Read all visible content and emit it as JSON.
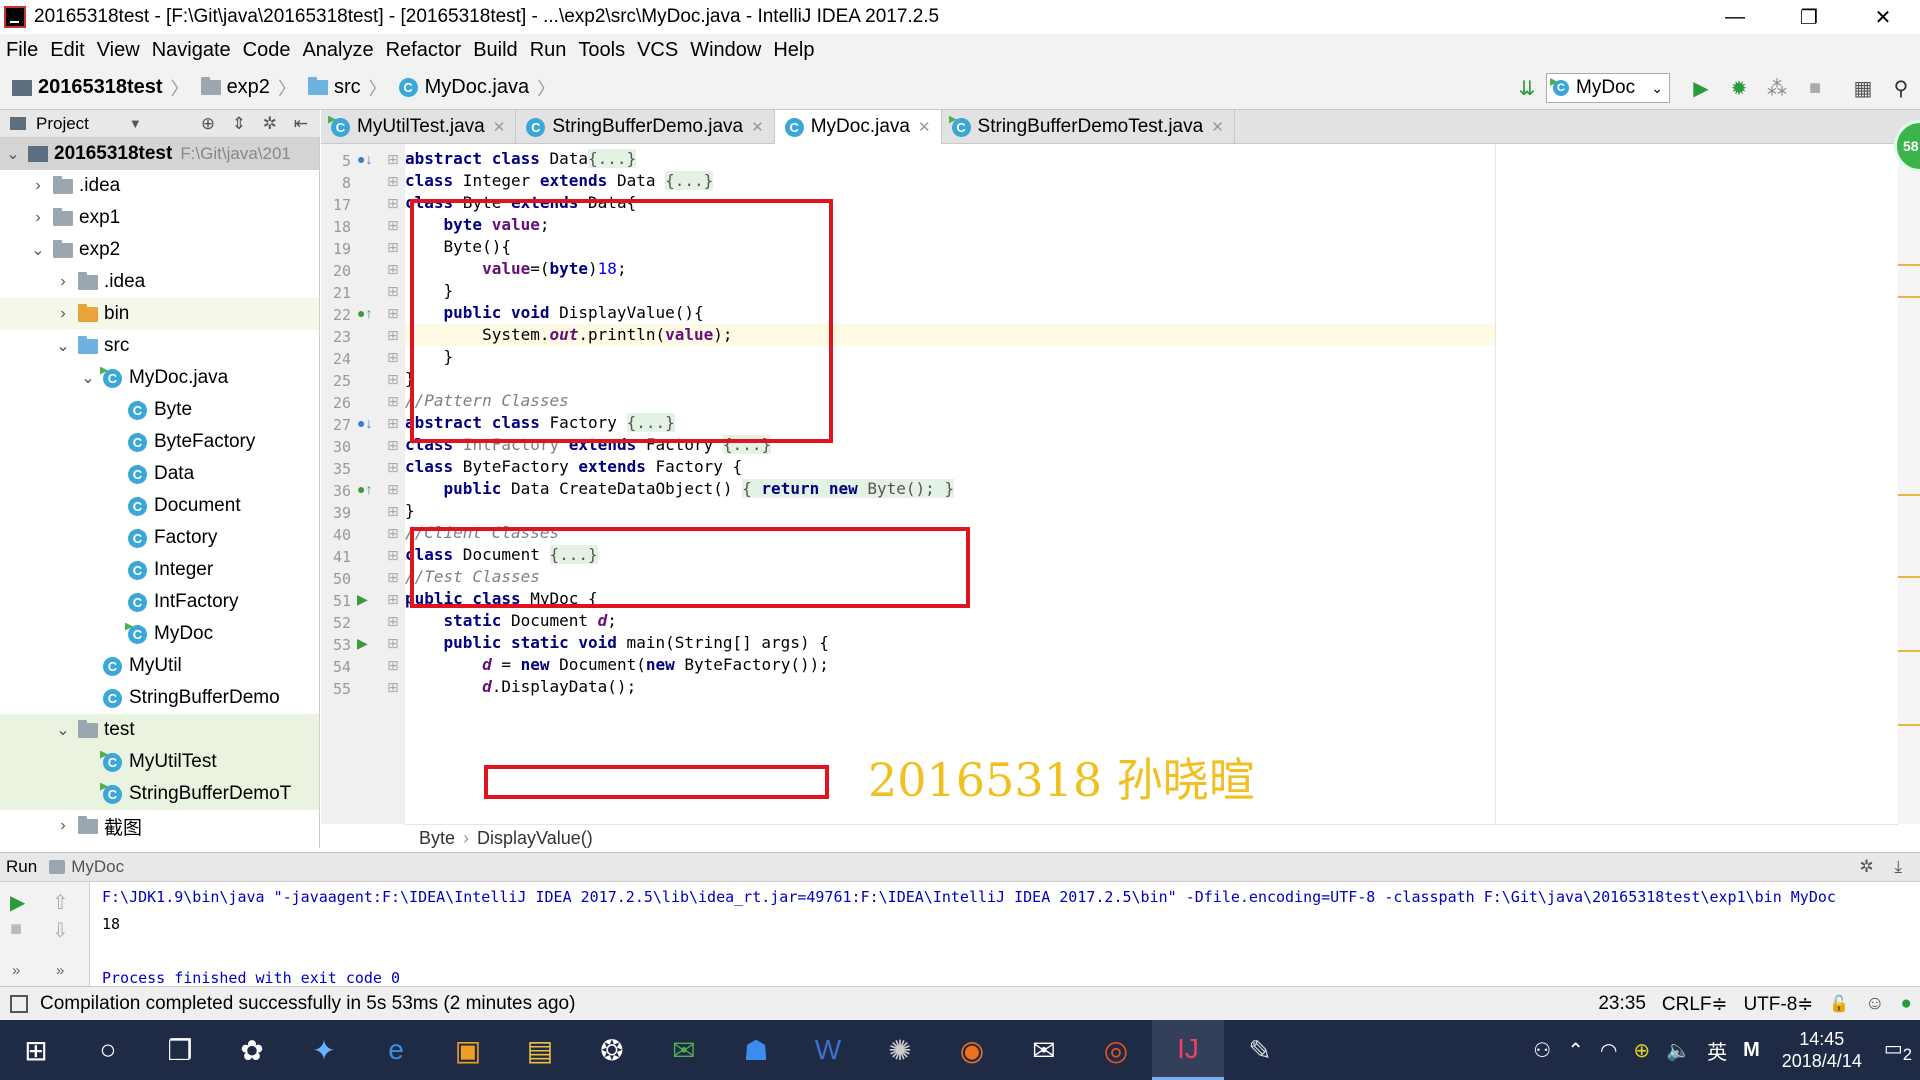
{
  "window": {
    "title": "20165318test - [F:\\Git\\java\\20165318test] - [20165318test] - ...\\exp2\\src\\MyDoc.java - IntelliJ IDEA 2017.2.5",
    "controls": [
      "—",
      "❐",
      "✕"
    ]
  },
  "menu": [
    "File",
    "Edit",
    "View",
    "Navigate",
    "Code",
    "Analyze",
    "Refactor",
    "Build",
    "Run",
    "Tools",
    "VCS",
    "Window",
    "Help"
  ],
  "nav": {
    "breadcrumbs": [
      "20165318test",
      "exp2",
      "src",
      "MyDoc.java"
    ],
    "run_config": "MyDoc"
  },
  "project_panel": {
    "title": "Project",
    "icons": "⊕ ⇕ ✲ ⇤"
  },
  "tree": [
    {
      "label": "20165318test",
      "muted": "F:\\Git\\java\\201",
      "level": 0,
      "arrow": "⌄",
      "kind": "module",
      "state": "sel"
    },
    {
      "label": ".idea",
      "level": 1,
      "arrow": "›",
      "kind": "folder"
    },
    {
      "label": "exp1",
      "level": 1,
      "arrow": "›",
      "kind": "folder"
    },
    {
      "label": "exp2",
      "level": 1,
      "arrow": "⌄",
      "kind": "folder"
    },
    {
      "label": ".idea",
      "level": 2,
      "arrow": "›",
      "kind": "folder"
    },
    {
      "label": "bin",
      "level": 2,
      "arrow": "›",
      "kind": "folder-orange",
      "state": "hl"
    },
    {
      "label": "src",
      "level": 2,
      "arrow": "⌄",
      "kind": "folder-blue"
    },
    {
      "label": "MyDoc.java",
      "level": 3,
      "arrow": "⌄",
      "kind": "class-run"
    },
    {
      "label": "Byte",
      "level": 4,
      "arrow": "",
      "kind": "class"
    },
    {
      "label": "ByteFactory",
      "level": 4,
      "arrow": "",
      "kind": "class"
    },
    {
      "label": "Data",
      "level": 4,
      "arrow": "",
      "kind": "class"
    },
    {
      "label": "Document",
      "level": 4,
      "arrow": "",
      "kind": "class"
    },
    {
      "label": "Factory",
      "level": 4,
      "arrow": "",
      "kind": "class"
    },
    {
      "label": "Integer",
      "level": 4,
      "arrow": "",
      "kind": "class"
    },
    {
      "label": "IntFactory",
      "level": 4,
      "arrow": "",
      "kind": "class"
    },
    {
      "label": "MyDoc",
      "level": 4,
      "arrow": "",
      "kind": "class-run"
    },
    {
      "label": "MyUtil",
      "level": 3,
      "arrow": "",
      "kind": "class"
    },
    {
      "label": "StringBufferDemo",
      "level": 3,
      "arrow": "",
      "kind": "class"
    },
    {
      "label": "test",
      "level": 2,
      "arrow": "⌄",
      "kind": "folder",
      "state": "hl2"
    },
    {
      "label": "MyUtilTest",
      "level": 3,
      "arrow": "",
      "kind": "class-run",
      "state": "hl2"
    },
    {
      "label": "StringBufferDemoT",
      "level": 3,
      "arrow": "",
      "kind": "class-run",
      "state": "hl2"
    },
    {
      "label": "截图",
      "level": 2,
      "arrow": "›",
      "kind": "folder"
    }
  ],
  "tabs": [
    {
      "label": "MyUtilTest.java",
      "active": false,
      "icon": "class-run"
    },
    {
      "label": "StringBufferDemo.java",
      "active": false,
      "icon": "class"
    },
    {
      "label": "MyDoc.java",
      "active": true,
      "icon": "class"
    },
    {
      "label": "StringBufferDemoTest.java",
      "active": false,
      "icon": "class-run"
    }
  ],
  "editor": {
    "lines": [
      {
        "n": "5",
        "html": "<span class='kw'>abstract class</span> Data<span class='fold'>{...}</span>",
        "mark": "impl"
      },
      {
        "n": "8",
        "html": "<span class='kw'>class</span> Integer <span class='kw'>extends</span> Data <span class='fold'>{...}</span>"
      },
      {
        "n": "17",
        "html": "<span class='kw'>class</span> Byte <span class='kw'>extends</span> Data{"
      },
      {
        "n": "18",
        "html": "    <span class='kw'>byte</span> <span class='fld'>value</span>;"
      },
      {
        "n": "19",
        "html": "    Byte(){"
      },
      {
        "n": "20",
        "html": "        <span class='fld'>value</span>=(<span class='kw'>byte</span>)<span class='num'>18</span>;"
      },
      {
        "n": "21",
        "html": "    }"
      },
      {
        "n": "22",
        "html": "    <span class='kw'>public void</span> DisplayValue(){",
        "mark": "override"
      },
      {
        "n": "23",
        "html": "        System.<span class='fld it'>out</span>.println(<span class='fld'>value</span>);",
        "current": true
      },
      {
        "n": "24",
        "html": "    }"
      },
      {
        "n": "25",
        "html": "}"
      },
      {
        "n": "26",
        "html": "<span class='cm'>//Pattern Classes</span>"
      },
      {
        "n": "27",
        "html": "<span class='kw'>abstract class</span> Factory <span class='fold'>{...}</span>",
        "mark": "impl"
      },
      {
        "n": "30",
        "html": "<span class='kw'>class</span> <span class='unused'>IntFactory</span> <span class='kw'>extends</span> Factory <span class='fold'>{...}</span>"
      },
      {
        "n": "35",
        "html": "<span class='kw'>class</span> ByteFactory <span class='kw'>extends</span> Factory {"
      },
      {
        "n": "36",
        "html": "    <span class='kw'>public</span> Data CreateDataObject() <span class='fold'>{ <span class='kw'>return new</span> Byte(); }</span>",
        "mark": "override"
      },
      {
        "n": "39",
        "html": "}"
      },
      {
        "n": "40",
        "html": "<span class='cm'>//Client Classes</span>"
      },
      {
        "n": "41",
        "html": "<span class='kw'>class</span> Document <span class='fold'>{...}</span>"
      },
      {
        "n": "50",
        "html": "<span class='cm'>//Test Classes</span>"
      },
      {
        "n": "51",
        "html": "<span class='kw'>public class</span> MyDoc {",
        "mark": "run"
      },
      {
        "n": "52",
        "html": "    <span class='kw'>static</span> Document <span class='fld it'>d</span>;"
      },
      {
        "n": "53",
        "html": "    <span class='kw'>public static void</span> main(String[] args) {",
        "mark": "run"
      },
      {
        "n": "54",
        "html": "        <span class='fld it'>d</span> = <span class='kw'>new</span> Document(<span class='kw'>new</span> ByteFactory());"
      },
      {
        "n": "55",
        "html": "        <span class='fld it'>d</span>.DisplayData();"
      }
    ],
    "watermark": "20165318 孙晓暄",
    "badge": "58",
    "crumbs": [
      "Byte",
      "DisplayValue()"
    ]
  },
  "run": {
    "label": "Run",
    "config": "MyDoc",
    "console": [
      "F:\\JDK1.9\\bin\\java \"-javaagent:F:\\IDEA\\IntelliJ IDEA 2017.2.5\\lib\\idea_rt.jar=49761:F:\\IDEA\\IntelliJ IDEA 2017.2.5\\bin\" -Dfile.encoding=UTF-8 -classpath F:\\Git\\java\\20165318test\\exp1\\bin MyDoc",
      "18",
      "",
      "Process finished with exit code 0"
    ]
  },
  "status": {
    "message": "Compilation completed successfully in 5s 53ms (2 minutes ago)",
    "position": "23:35",
    "line_sep": "CRLF≑",
    "encoding": "UTF-8≑"
  },
  "taskbar": {
    "time": "14:45",
    "date": "2018/4/14",
    "ime": "英",
    "notif": "2"
  }
}
